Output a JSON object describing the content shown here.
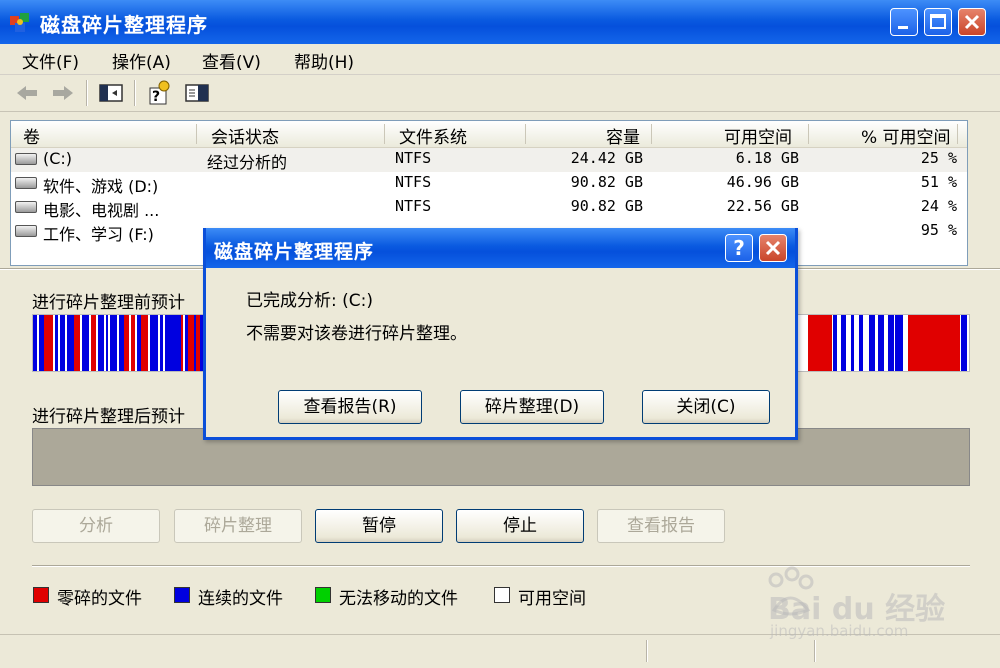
{
  "window": {
    "title": "磁盘碎片整理程序"
  },
  "menu": [
    {
      "label": "文件(F)"
    },
    {
      "label": "操作(A)"
    },
    {
      "label": "查看(V)"
    },
    {
      "label": "帮助(H)"
    }
  ],
  "columns": [
    "卷",
    "会话状态",
    "文件系统",
    "容量",
    "可用空间",
    "% 可用空间"
  ],
  "volumes": [
    {
      "name": "(C:)",
      "status": "经过分析的",
      "fs": "NTFS",
      "capacity": "24.42 GB",
      "free": "6.18 GB",
      "pct": "25 %"
    },
    {
      "name": "软件、游戏 (D:)",
      "status": "",
      "fs": "NTFS",
      "capacity": "90.82 GB",
      "free": "46.96 GB",
      "pct": "51 %"
    },
    {
      "name": "电影、电视剧 ...",
      "status": "",
      "fs": "NTFS",
      "capacity": "90.82 GB",
      "free": "22.56 GB",
      "pct": "24 %"
    },
    {
      "name": "工作、学习 (F:)",
      "status": "",
      "fs": "",
      "capacity": "",
      "free": "",
      "pct": "95 %"
    }
  ],
  "panel": {
    "before_label": "进行碎片整理前预计",
    "after_label": "进行碎片整理后预计"
  },
  "buttons": {
    "analyze": "分析",
    "defrag": "碎片整理",
    "pause": "暂停",
    "stop": "停止",
    "report": "查看报告"
  },
  "legend": [
    {
      "label": "零碎的文件",
      "color": "#e00000"
    },
    {
      "label": "连续的文件",
      "color": "#0000e0"
    },
    {
      "label": "无法移动的文件",
      "color": "#00d000"
    },
    {
      "label": "可用空间",
      "color": "#ffffff"
    }
  ],
  "dialog": {
    "title": "磁盘碎片整理程序",
    "help_symbol": "?",
    "line1": "已完成分析: (C:)",
    "line2": "不需要对该卷进行碎片整理。",
    "btn_report": "查看报告(R)",
    "btn_defrag": "碎片整理(D)",
    "btn_close": "关闭(C)"
  },
  "watermark": {
    "brand": "Bai du 经验",
    "url": "jingyan.baidu.com"
  }
}
